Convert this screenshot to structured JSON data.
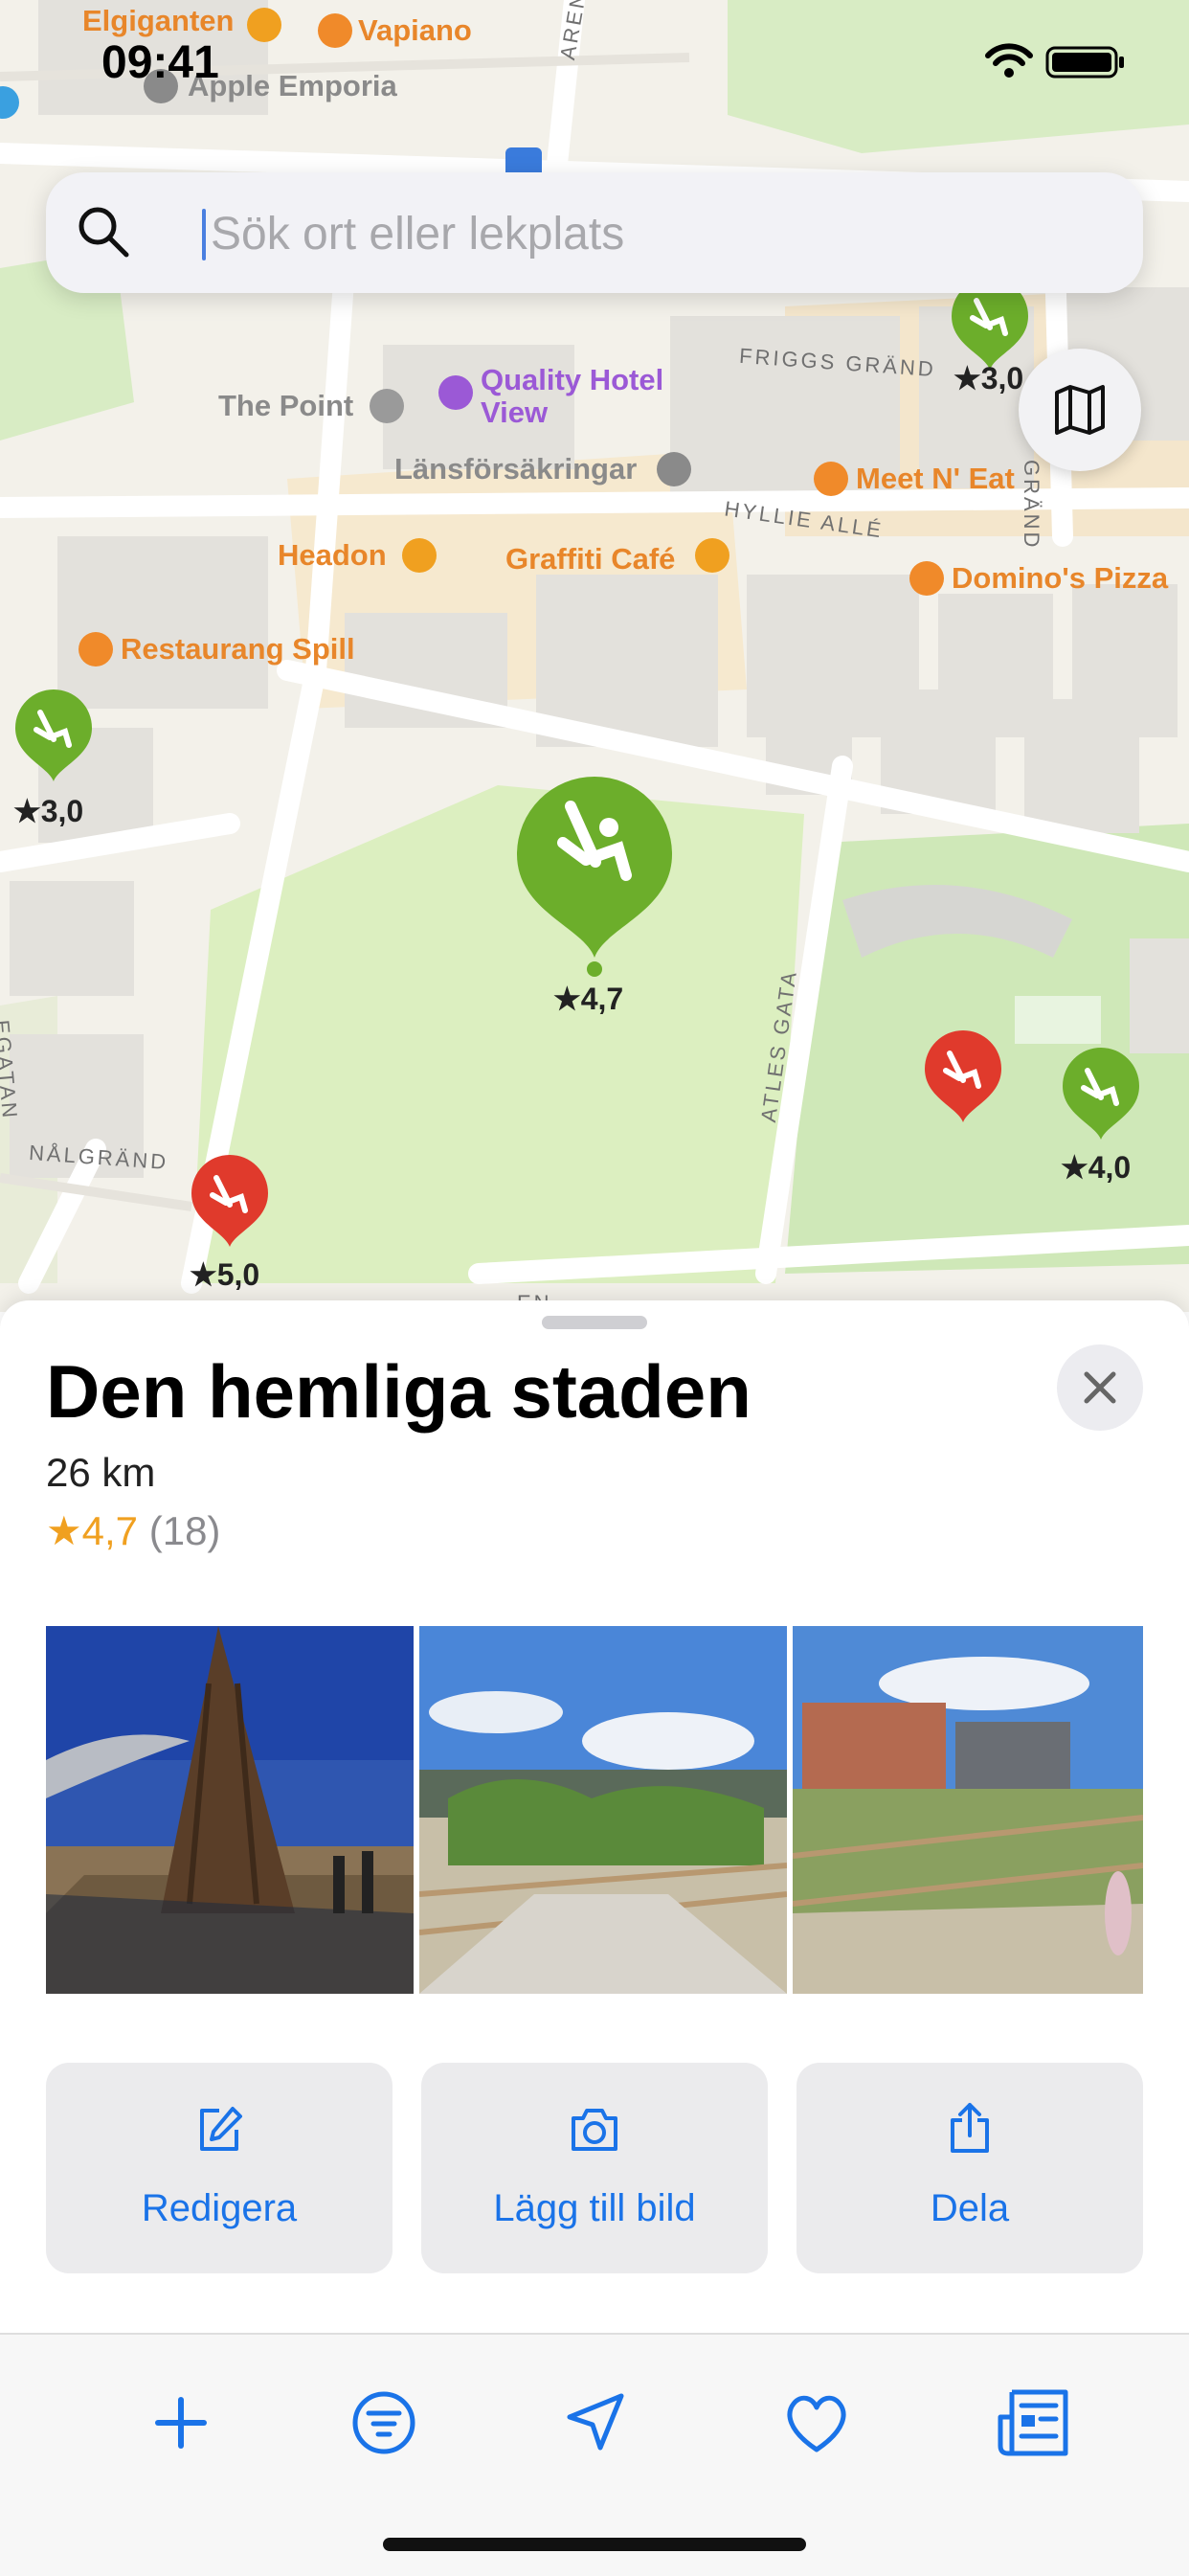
{
  "status_bar": {
    "time": "09:41"
  },
  "search": {
    "placeholder": "Sök ort eller lekplats",
    "value": ""
  },
  "map": {
    "pois": [
      {
        "name": "Elgiganten",
        "color": "#e8862a"
      },
      {
        "name": "Vapiano",
        "color": "#e8862a"
      },
      {
        "name": "Apple Emporia",
        "color": "#8a8a8a"
      },
      {
        "name": "The Point",
        "color": "#8a8a8a"
      },
      {
        "name": "Quality Hotel View",
        "color": "#9b59d6"
      },
      {
        "name": "Länsförsäkringar",
        "color": "#8a8a8a"
      },
      {
        "name": "Meet N' Eat",
        "color": "#e8862a"
      },
      {
        "name": "Headon",
        "color": "#e8862a"
      },
      {
        "name": "Graffiti Café",
        "color": "#e8862a"
      },
      {
        "name": "Domino's Pizza",
        "color": "#e8862a"
      },
      {
        "name": "Restaurang Spill",
        "color": "#e8862a"
      }
    ],
    "streets": [
      "ARENAG",
      "FRIGGS GRÄND",
      "HYLLIE ALLÉ",
      "GRÄND",
      "ATLES GATA",
      "NÅLGRÄND",
      "EGATAN",
      "EN"
    ],
    "playgrounds": [
      {
        "rating": "3,0",
        "color": "green"
      },
      {
        "rating": "3,0",
        "color": "green"
      },
      {
        "rating": "4,7",
        "color": "green",
        "selected": true
      },
      {
        "rating": "",
        "color": "red"
      },
      {
        "rating": "4,0",
        "color": "green"
      },
      {
        "rating": "5,0",
        "color": "red"
      }
    ]
  },
  "place": {
    "title": "Den hemliga staden",
    "distance": "26 km",
    "rating_star": "★",
    "rating": "4,7",
    "review_count": "(18)"
  },
  "actions": [
    {
      "label": "Redigera",
      "icon": "edit-icon"
    },
    {
      "label": "Lägg till bild",
      "icon": "camera-icon"
    },
    {
      "label": "Dela",
      "icon": "share-icon"
    }
  ],
  "tabbar": [
    {
      "icon": "plus-icon"
    },
    {
      "icon": "filter-icon"
    },
    {
      "icon": "location-arrow-icon"
    },
    {
      "icon": "heart-icon"
    },
    {
      "icon": "news-icon"
    }
  ],
  "colors": {
    "accent": "#1a73e8",
    "pin_green": "#6cae2b",
    "pin_red": "#e03a2c",
    "star": "#f0a020"
  }
}
